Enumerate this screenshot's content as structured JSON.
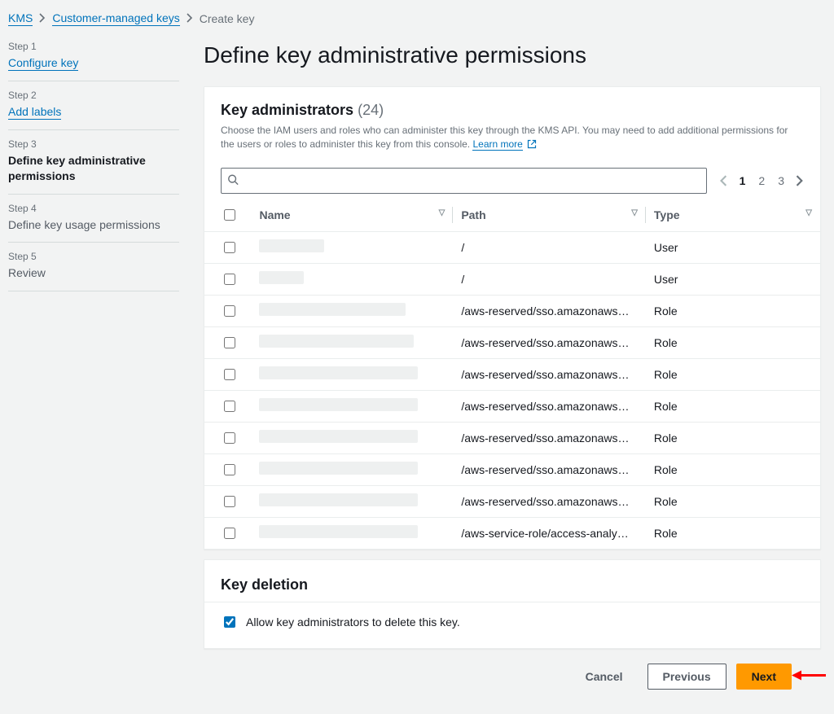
{
  "breadcrumb": {
    "kms": "KMS",
    "cmk": "Customer-managed keys",
    "current": "Create key"
  },
  "steps": [
    {
      "label": "Step 1",
      "title": "Configure key",
      "link": true
    },
    {
      "label": "Step 2",
      "title": "Add labels",
      "link": true
    },
    {
      "label": "Step 3",
      "title": "Define key administrative permissions",
      "active": true
    },
    {
      "label": "Step 4",
      "title": "Define key usage permissions"
    },
    {
      "label": "Step 5",
      "title": "Review"
    }
  ],
  "main": {
    "heading": "Define key administrative permissions",
    "key_admin": {
      "title": "Key administrators",
      "count": "(24)",
      "desc_pre": "Choose the IAM users and roles who can administer this key through the KMS API. You may need to add additional permissions for the users or roles to administer this key from this console. ",
      "learn_more": "Learn more"
    },
    "search": {
      "placeholder": ""
    },
    "pager": {
      "pages": [
        "1",
        "2",
        "3"
      ],
      "active": 0
    },
    "columns": {
      "name": "Name",
      "path": "Path",
      "type": "Type"
    },
    "rows": [
      {
        "name_blur_w": 80,
        "path": "/",
        "type": "User"
      },
      {
        "name_blur_w": 55,
        "path": "/",
        "type": "User"
      },
      {
        "name_blur_w": 180,
        "path": "/aws-reserved/sso.amazonaws…",
        "type": "Role"
      },
      {
        "name_blur_w": 190,
        "path": "/aws-reserved/sso.amazonaws…",
        "type": "Role"
      },
      {
        "name_blur_w": 195,
        "path": "/aws-reserved/sso.amazonaws…",
        "type": "Role"
      },
      {
        "name_blur_w": 195,
        "path": "/aws-reserved/sso.amazonaws…",
        "type": "Role"
      },
      {
        "name_blur_w": 195,
        "path": "/aws-reserved/sso.amazonaws…",
        "type": "Role"
      },
      {
        "name_blur_w": 195,
        "path": "/aws-reserved/sso.amazonaws…",
        "type": "Role"
      },
      {
        "name_blur_w": 195,
        "path": "/aws-reserved/sso.amazonaws…",
        "type": "Role"
      },
      {
        "name_blur_w": 195,
        "path": "/aws-service-role/access-analy…",
        "type": "Role"
      }
    ],
    "key_deletion": {
      "title": "Key deletion",
      "checkbox_label": "Allow key administrators to delete this key.",
      "checked": true
    },
    "buttons": {
      "cancel": "Cancel",
      "previous": "Previous",
      "next": "Next"
    }
  }
}
